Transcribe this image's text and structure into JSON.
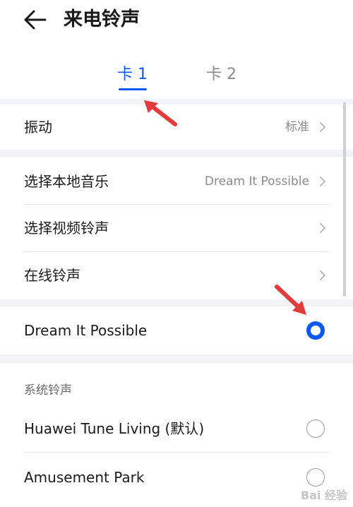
{
  "header": {
    "title": "来电铃声"
  },
  "tabs": [
    {
      "label": "卡 1"
    },
    {
      "label": "卡 2"
    }
  ],
  "vibration": {
    "label": "振动",
    "value": "标准"
  },
  "options": {
    "local_music": {
      "label": "选择本地音乐",
      "value": "Dream It Possible"
    },
    "video_ringtone": {
      "label": "选择视频铃声"
    },
    "online_ringtone": {
      "label": "在线铃声"
    }
  },
  "current": {
    "label": "Dream It Possible",
    "selected": true
  },
  "system": {
    "title": "系统铃声",
    "items": [
      {
        "label": "Huawei Tune Living (默认)",
        "selected": false
      },
      {
        "label": "Amusement Park",
        "selected": false
      }
    ]
  },
  "watermark": "Bai 经验",
  "colors": {
    "accent": "#0a59f7",
    "annotation_arrow": "#e23b3b"
  }
}
